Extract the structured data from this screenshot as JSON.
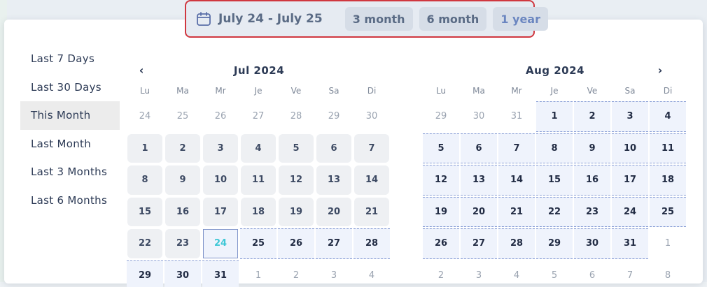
{
  "range_bar": {
    "label": "July 24 - July 25",
    "chips": [
      "3 month",
      "6 month",
      "1 year"
    ],
    "active_chip": "1 year"
  },
  "presets": [
    "Last 7 Days",
    "Last 30 Days",
    "This Month",
    "Last Month",
    "Last 3 Months",
    "Last 6 Months"
  ],
  "selected_preset": "This Month",
  "weekdays": [
    "Lu",
    "Ma",
    "Mr",
    "Je",
    "Ve",
    "Sa",
    "Di"
  ],
  "months": [
    {
      "title": "Jul 2024",
      "nav": "‹",
      "days": [
        {
          "n": "24",
          "s": "outside"
        },
        {
          "n": "25",
          "s": "outside"
        },
        {
          "n": "26",
          "s": "outside"
        },
        {
          "n": "27",
          "s": "outside"
        },
        {
          "n": "28",
          "s": "outside"
        },
        {
          "n": "29",
          "s": "outside"
        },
        {
          "n": "30",
          "s": "outside"
        },
        {
          "n": "1",
          "s": "past"
        },
        {
          "n": "2",
          "s": "past"
        },
        {
          "n": "3",
          "s": "past"
        },
        {
          "n": "4",
          "s": "past"
        },
        {
          "n": "5",
          "s": "past"
        },
        {
          "n": "6",
          "s": "past"
        },
        {
          "n": "7",
          "s": "past"
        },
        {
          "n": "8",
          "s": "past"
        },
        {
          "n": "9",
          "s": "past"
        },
        {
          "n": "10",
          "s": "past"
        },
        {
          "n": "11",
          "s": "past"
        },
        {
          "n": "12",
          "s": "past"
        },
        {
          "n": "13",
          "s": "past"
        },
        {
          "n": "14",
          "s": "past"
        },
        {
          "n": "15",
          "s": "past"
        },
        {
          "n": "16",
          "s": "past"
        },
        {
          "n": "17",
          "s": "past"
        },
        {
          "n": "18",
          "s": "past"
        },
        {
          "n": "19",
          "s": "past"
        },
        {
          "n": "20",
          "s": "past"
        },
        {
          "n": "21",
          "s": "past"
        },
        {
          "n": "22",
          "s": "past"
        },
        {
          "n": "23",
          "s": "past"
        },
        {
          "n": "24",
          "s": "start"
        },
        {
          "n": "25",
          "s": "inrange"
        },
        {
          "n": "26",
          "s": "inrange"
        },
        {
          "n": "27",
          "s": "inrange"
        },
        {
          "n": "28",
          "s": "inrange"
        },
        {
          "n": "29",
          "s": "inrange"
        },
        {
          "n": "30",
          "s": "inrange"
        },
        {
          "n": "31",
          "s": "inrange"
        },
        {
          "n": "1",
          "s": "outside"
        },
        {
          "n": "2",
          "s": "outside"
        },
        {
          "n": "3",
          "s": "outside"
        },
        {
          "n": "4",
          "s": "outside"
        }
      ]
    },
    {
      "title": "Aug 2024",
      "nav": "›",
      "days": [
        {
          "n": "29",
          "s": "outside"
        },
        {
          "n": "30",
          "s": "outside"
        },
        {
          "n": "31",
          "s": "outside"
        },
        {
          "n": "1",
          "s": "inrange"
        },
        {
          "n": "2",
          "s": "inrange"
        },
        {
          "n": "3",
          "s": "inrange"
        },
        {
          "n": "4",
          "s": "inrange"
        },
        {
          "n": "5",
          "s": "inrange"
        },
        {
          "n": "6",
          "s": "inrange"
        },
        {
          "n": "7",
          "s": "inrange"
        },
        {
          "n": "8",
          "s": "inrange"
        },
        {
          "n": "9",
          "s": "inrange"
        },
        {
          "n": "10",
          "s": "inrange"
        },
        {
          "n": "11",
          "s": "inrange"
        },
        {
          "n": "12",
          "s": "inrange"
        },
        {
          "n": "13",
          "s": "inrange"
        },
        {
          "n": "14",
          "s": "inrange"
        },
        {
          "n": "15",
          "s": "inrange"
        },
        {
          "n": "16",
          "s": "inrange"
        },
        {
          "n": "17",
          "s": "inrange"
        },
        {
          "n": "18",
          "s": "inrange"
        },
        {
          "n": "19",
          "s": "inrange"
        },
        {
          "n": "20",
          "s": "inrange"
        },
        {
          "n": "21",
          "s": "inrange"
        },
        {
          "n": "22",
          "s": "inrange"
        },
        {
          "n": "23",
          "s": "inrange"
        },
        {
          "n": "24",
          "s": "inrange"
        },
        {
          "n": "25",
          "s": "inrange"
        },
        {
          "n": "26",
          "s": "inrange"
        },
        {
          "n": "27",
          "s": "inrange"
        },
        {
          "n": "28",
          "s": "inrange"
        },
        {
          "n": "29",
          "s": "inrange"
        },
        {
          "n": "30",
          "s": "inrange"
        },
        {
          "n": "31",
          "s": "inrange"
        },
        {
          "n": "1",
          "s": "outside"
        },
        {
          "n": "2",
          "s": "outside"
        },
        {
          "n": "3",
          "s": "outside"
        },
        {
          "n": "4",
          "s": "outside"
        },
        {
          "n": "5",
          "s": "outside"
        },
        {
          "n": "6",
          "s": "outside"
        },
        {
          "n": "7",
          "s": "outside"
        },
        {
          "n": "8",
          "s": "outside"
        }
      ]
    }
  ],
  "colors": {
    "highlight_border": "#d0373f",
    "range_fill": "#eff3fc",
    "range_dash": "#8a9fd6",
    "start_day_text": "#3fc7d6",
    "preset_selected_bg": "#ececec"
  }
}
